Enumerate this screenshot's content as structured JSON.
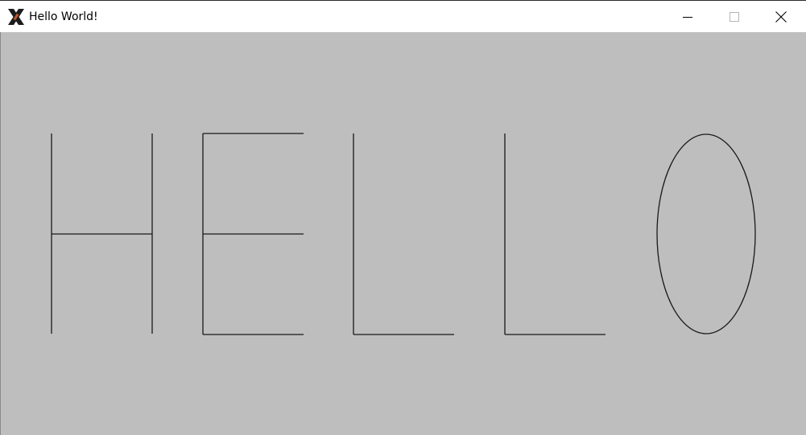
{
  "window": {
    "title": "Hello World!",
    "canvas_background": "#bebebe",
    "stroke_color": "#1a1a1a",
    "icons": {
      "app": "x11-logo-icon",
      "minimize": "minimize-icon",
      "maximize": "maximize-icon",
      "close": "close-icon"
    }
  }
}
